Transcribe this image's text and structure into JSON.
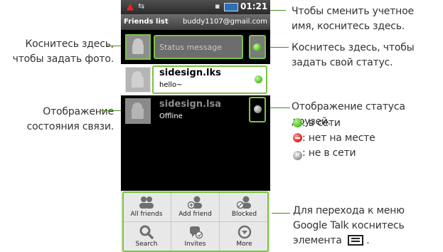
{
  "callouts": {
    "photo": "Коснитесь здесь,\nчтобы задать фото.",
    "account": "Чтобы сменить учетное\nимя, коснитесь здесь.",
    "status": "Коснитесь здесь, чтобы\nзадать свой статус.",
    "connection": "Отображение\nсостояния связи.",
    "friends_status_title": "Отображение статуса друзей.",
    "legend": [
      {
        "label": ": в сети",
        "color": "#5cc830",
        "icon": "online-dot-icon"
      },
      {
        "label": ": нет на месте",
        "color": "#e03030",
        "icon": "busy-dot-icon"
      },
      {
        "label": ": не в сети",
        "color": "#a0a0a0",
        "icon": "offline-dot-icon"
      }
    ],
    "menu_line1": "Для перехода к меню",
    "menu_line2": "Google Talk коснитесь",
    "menu_line3": "элемента",
    "menu_line3_end": "."
  },
  "phone": {
    "time": "01:21",
    "title": "Friends list",
    "account": "buddy1107@gmail.com",
    "status_placeholder": "Status message",
    "friends": [
      {
        "name": "sidesign.lks",
        "status": "hello~",
        "state": "online"
      },
      {
        "name": "sidesign.lsa",
        "status": "Offline",
        "state": "offline"
      }
    ],
    "menu": [
      {
        "label": "All friends",
        "icon": "all-friends-icon"
      },
      {
        "label": "Add friend",
        "icon": "add-friend-icon"
      },
      {
        "label": "Blocked",
        "icon": "blocked-icon"
      },
      {
        "label": "Search",
        "icon": "search-icon"
      },
      {
        "label": "Invites",
        "icon": "invites-icon"
      },
      {
        "label": "More",
        "icon": "more-icon"
      }
    ]
  },
  "colors": {
    "accent": "#7cc243",
    "online": "#5cc830",
    "busy": "#e03030",
    "offline": "#a0a0a0"
  }
}
